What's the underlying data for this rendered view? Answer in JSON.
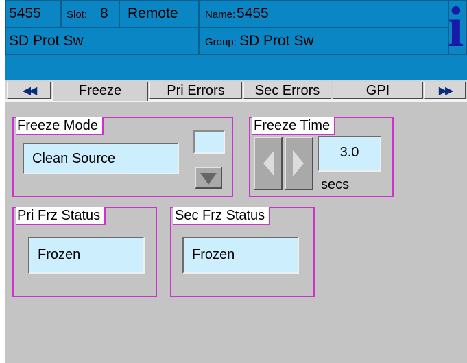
{
  "header": {
    "unit_id": "5455",
    "slot_label": "Slot:",
    "slot_value": "8",
    "mode": "Remote",
    "name_label": "Name:",
    "name_value": "5455",
    "device_type": "SD Prot Sw",
    "group_label": "Group:",
    "group_value": "SD Prot Sw",
    "info_glyph": "i"
  },
  "tabs": {
    "prev_glyph": "◀◀",
    "next_glyph": "▶▶",
    "items": [
      {
        "label": "Freeze",
        "selected": true
      },
      {
        "label": "Pri Errors",
        "selected": false
      },
      {
        "label": "Sec Errors",
        "selected": false
      },
      {
        "label": "GPI",
        "selected": false
      }
    ]
  },
  "freeze_mode": {
    "title": "Freeze Mode",
    "value": "Clean Source"
  },
  "freeze_time": {
    "title": "Freeze Time",
    "value": "3.0",
    "unit": "secs"
  },
  "pri_status": {
    "title": "Pri Frz Status",
    "value": "Frozen"
  },
  "sec_status": {
    "title": "Sec Frz Status",
    "value": "Frozen"
  },
  "colors": {
    "header_bg": "#0a86c4",
    "panel_bg": "#c4c4c4",
    "group_border": "#cc33cc",
    "value_bg": "#cdeefc",
    "info_icon": "#1a1aa8"
  },
  "icons": [
    "prev-double-arrow-icon",
    "next-double-arrow-icon",
    "info-icon",
    "dropdown-arrow-icon",
    "left-arrow-icon",
    "right-arrow-icon"
  ]
}
